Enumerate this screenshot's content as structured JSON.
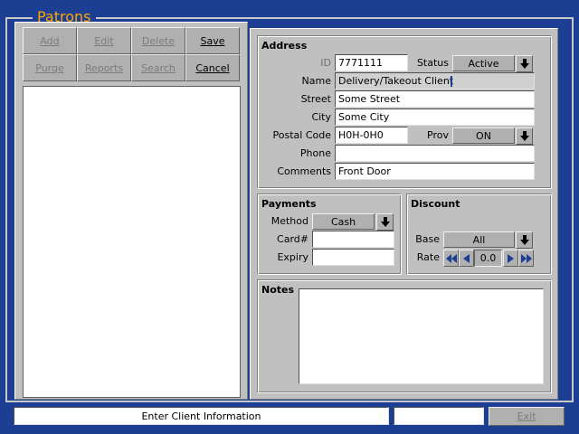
{
  "window": {
    "title": "Patrons"
  },
  "toolbar": {
    "buttons": [
      {
        "label": "Add",
        "enabled": false
      },
      {
        "label": "Edit",
        "enabled": false
      },
      {
        "label": "Delete",
        "enabled": false
      },
      {
        "label": "Save",
        "enabled": true
      },
      {
        "label": "Purge",
        "enabled": false
      },
      {
        "label": "Reports",
        "enabled": false
      },
      {
        "label": "Search",
        "enabled": false
      },
      {
        "label": "Cancel",
        "enabled": true
      }
    ]
  },
  "address": {
    "title": "Address",
    "id_label": "ID",
    "id_value": "7771111",
    "status_label": "Status",
    "status_value": "Active",
    "name_label": "Name",
    "name_value": "Delivery/Takeout Client",
    "street_label": "Street",
    "street_value": "Some Street",
    "city_label": "City",
    "city_value": "Some City",
    "postal_label": "Postal Code",
    "postal_value": "H0H-0H0",
    "prov_label": "Prov",
    "prov_value": "ON",
    "phone_label": "Phone",
    "phone_value": "",
    "comments_label": "Comments",
    "comments_value": "Front Door"
  },
  "payments": {
    "title": "Payments",
    "method_label": "Method",
    "method_value": "Cash",
    "card_label": "Card#",
    "card_value": "",
    "expiry_label": "Expiry",
    "expiry_value": ""
  },
  "discount": {
    "title": "Discount",
    "base_label": "Base",
    "base_value": "All",
    "rate_label": "Rate",
    "rate_value": "0.0"
  },
  "notes": {
    "title": "Notes",
    "value": ""
  },
  "statusbar": {
    "message": "Enter Client Information",
    "secondary": "",
    "exit_label": "Exit"
  },
  "colors": {
    "background": "#1c3f94",
    "title": "#ffa500",
    "panel": "#c0c0c0",
    "accent_icon": "#1c3f94"
  },
  "icons": {
    "dropdown": "down-arrow-icon",
    "rate_fast_down": "double-left-arrow-icon",
    "rate_down": "left-arrow-icon",
    "rate_up": "right-arrow-icon",
    "rate_fast_up": "double-right-arrow-icon"
  }
}
